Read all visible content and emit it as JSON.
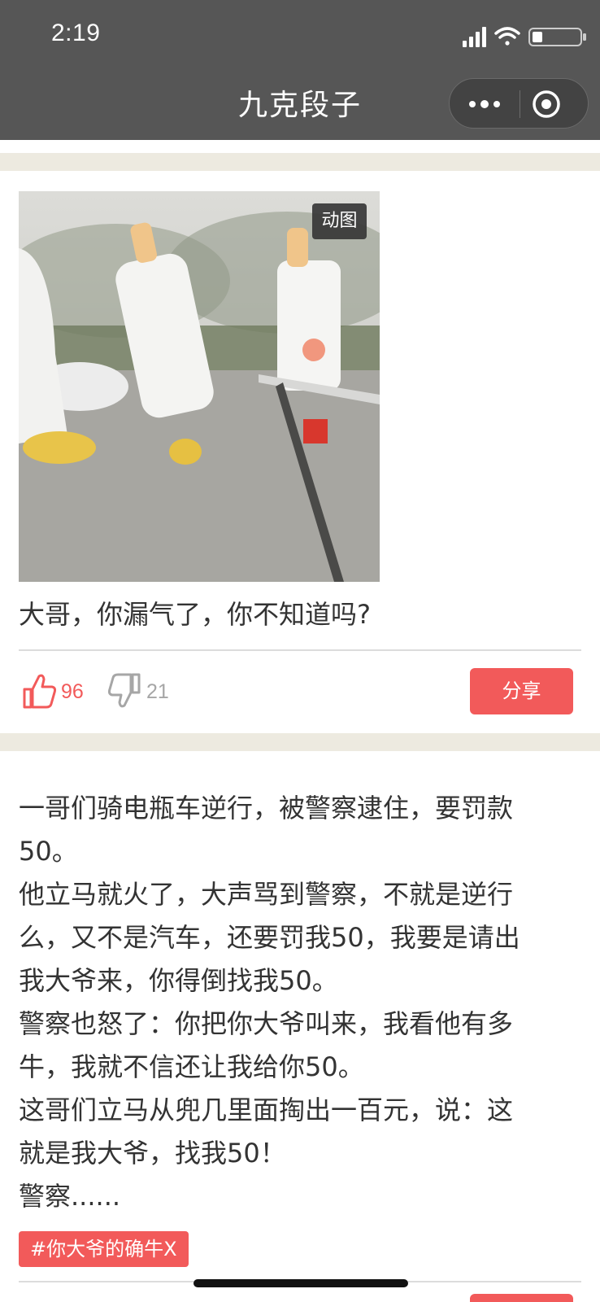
{
  "status_bar": {
    "time": "2:19"
  },
  "nav": {
    "title": "九克段子",
    "more_icon": "more-dots-icon",
    "close_icon": "target-circle-icon"
  },
  "post1": {
    "badge": "动图",
    "caption": "大哥，你漏气了，你不知道吗?",
    "like_count": "96",
    "dislike_count": "21",
    "share_label": "分享"
  },
  "post2": {
    "lines": [
      "一哥们骑电瓶车逆行，被警察逮住，要罚款",
      "50。",
      "他立马就火了，大声骂到警察，不就是逆行",
      "么，又不是汽车，还要罚我50，我要是请出",
      "我大爷来，你得倒找我50。",
      "警察也怒了：你把你大爷叫来，我看他有多",
      "牛，我就不信还让我给你50。",
      "这哥们立马从兜几里面掏出一百元，说：这",
      "就是我大爷，找我50！",
      "警察......"
    ],
    "tag": "#你大爷的确牛X"
  },
  "colors": {
    "accent": "#f25a5a",
    "nav_bg": "#565656",
    "band": "#edeae0",
    "text": "#333333",
    "muted": "#a6a6a6"
  }
}
